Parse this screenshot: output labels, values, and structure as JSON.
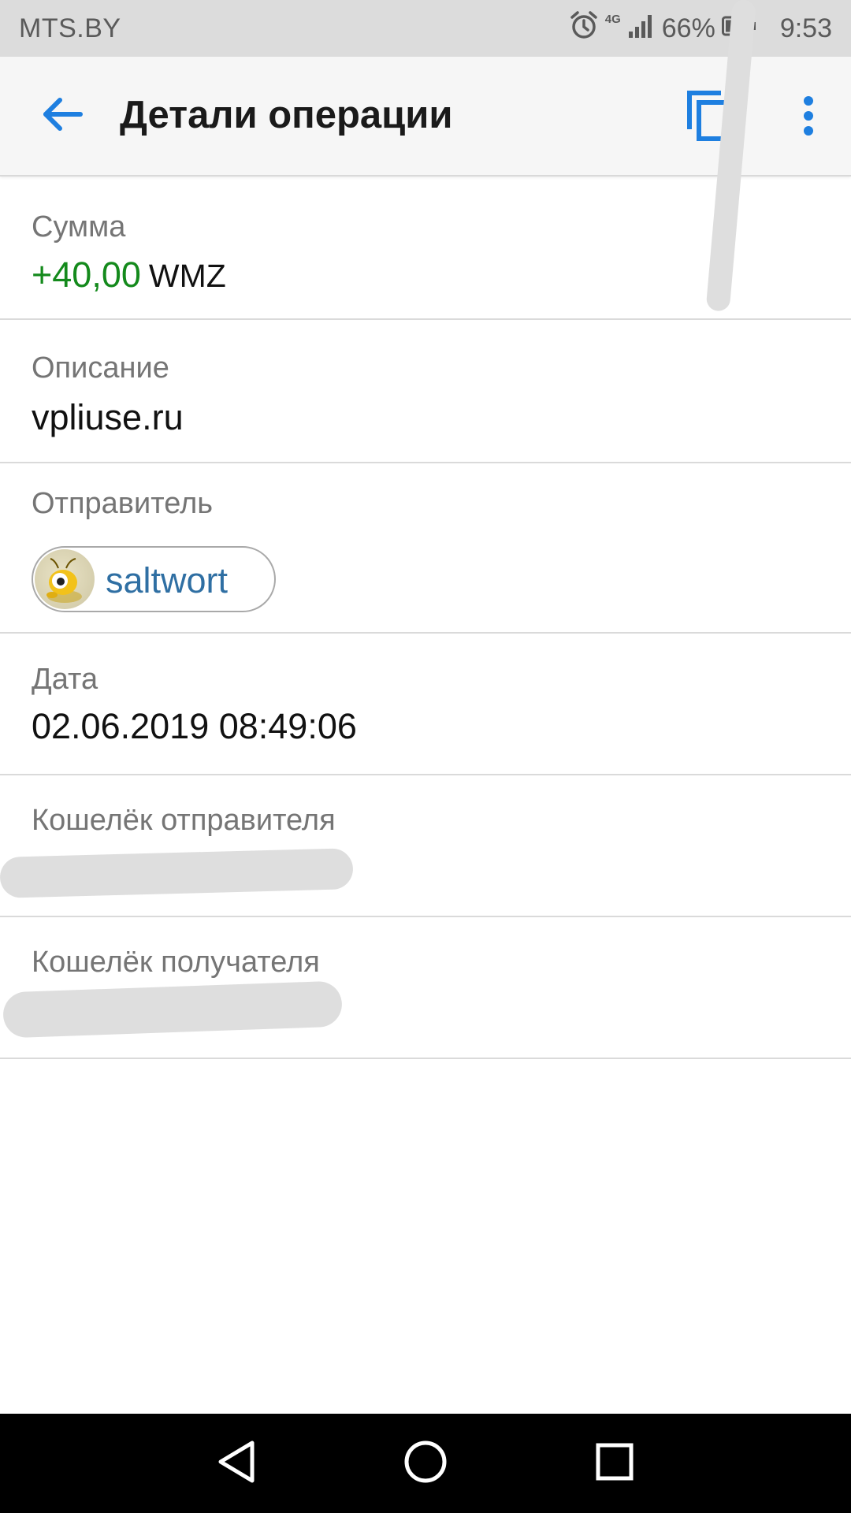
{
  "status_bar": {
    "carrier": "MTS.BY",
    "network": "4G",
    "battery": "66%",
    "time": "9:53",
    "icons": [
      "alarm-icon",
      "signal-icon",
      "battery-icon"
    ]
  },
  "app_bar": {
    "title": "Детали операции",
    "icons": [
      "arrow-back-icon",
      "copy-icon",
      "more-vert-icon"
    ],
    "accent_color": "#1e7fe0"
  },
  "details": {
    "amount": {
      "label": "Сумма",
      "value": "+40,00",
      "currency": "WMZ",
      "value_color": "#148a1c"
    },
    "description": {
      "label": "Описание",
      "value": "vpliuse.ru"
    },
    "sender": {
      "label": "Отправитель",
      "name": "saltwort",
      "name_color": "#2f6fa3"
    },
    "date": {
      "label": "Дата",
      "value": "02.06.2019 08:49:06"
    },
    "sender_wallet": {
      "label": "Кошелёк отправителя"
    },
    "recipient_wallet": {
      "label": "Кошелёк получателя"
    }
  },
  "nav_bar": {
    "icons": [
      "nav-back-icon",
      "nav-home-icon",
      "nav-recents-icon"
    ]
  }
}
